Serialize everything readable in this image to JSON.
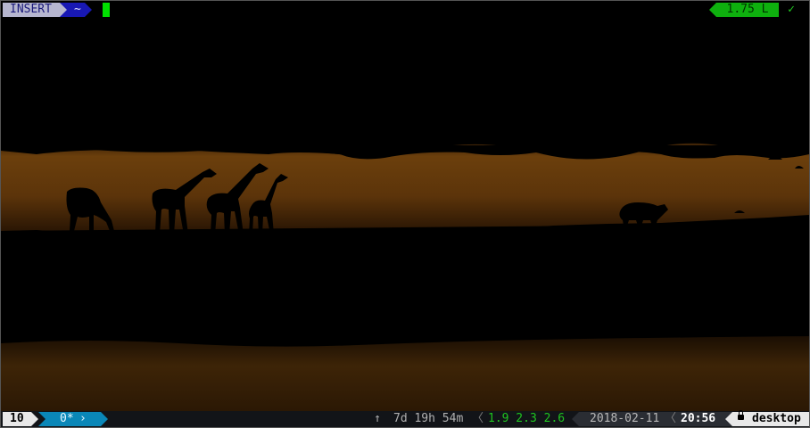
{
  "prompt": {
    "mode": "INSERT",
    "directory": "~",
    "load_indicator": "1.75 L",
    "status_icon": "check-icon",
    "status_glyph": "✓"
  },
  "statusbar": {
    "session": "10",
    "window_index": "0*",
    "uptime_icon": "up-arrow-icon",
    "uptime_glyph": "↑",
    "uptime": "7d 19h 54m",
    "separator": "〈",
    "load_average": "1.9 2.3 2.6",
    "date": "2018-02-11",
    "time": "20:56",
    "host_icon": "lock-icon",
    "hostname": "desktop"
  },
  "wallpaper": {
    "description_icon": "savanna-silhouette",
    "colors": {
      "sky_glow": "#6b3f0c",
      "ground": "#000000"
    }
  },
  "colors": {
    "mode_bg": "#b6b6cf",
    "dir_bg": "#1818b4",
    "load_bg": "#0eb00e",
    "window_bg": "#0a87b8",
    "cursor": "#00e000"
  }
}
